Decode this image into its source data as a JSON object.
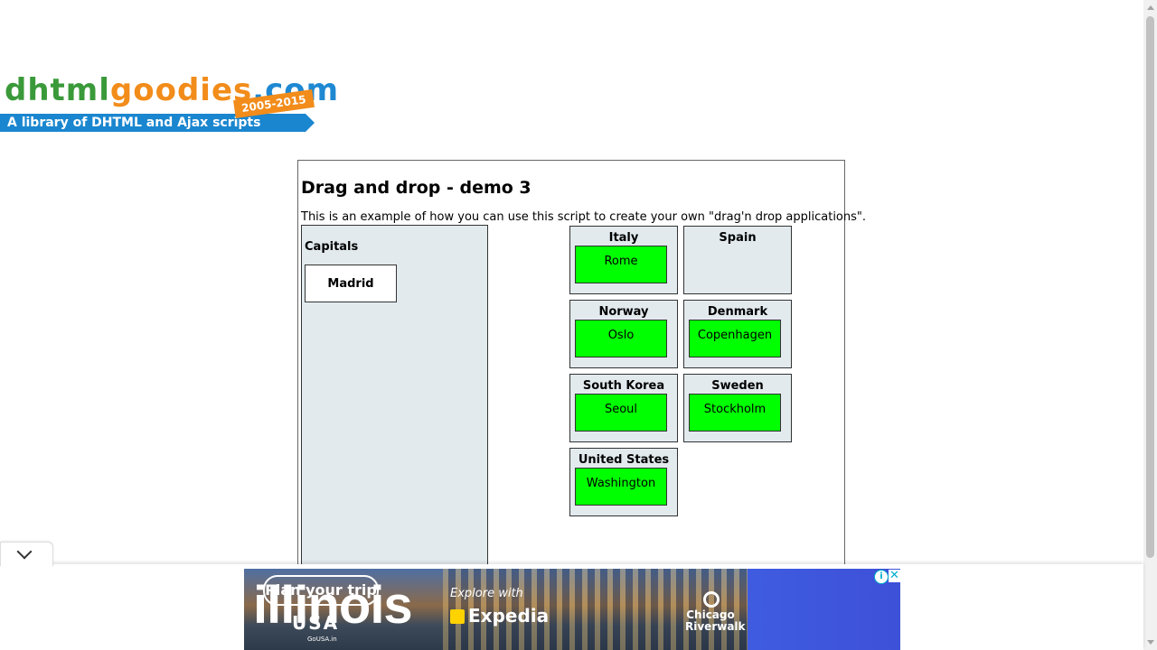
{
  "logo": {
    "part1": "dhtml",
    "part2": "goodies",
    "part3": ".com",
    "tagline": "A library of DHTML and Ajax scripts",
    "years": "2005-2015"
  },
  "page": {
    "title": "Drag and drop - demo 3",
    "intro": "This is an example of how you can use this script to create your own \"drag'n drop applications\"."
  },
  "capitals_box": {
    "title": "Capitals",
    "items": [
      "Madrid"
    ]
  },
  "countries": [
    {
      "name": "Italy",
      "capital": "Rome"
    },
    {
      "name": "Spain",
      "capital": ""
    },
    {
      "name": "Norway",
      "capital": "Oslo"
    },
    {
      "name": "Denmark",
      "capital": "Copenhagen"
    },
    {
      "name": "South Korea",
      "capital": "Seoul"
    },
    {
      "name": "Sweden",
      "capital": "Stockholm"
    },
    {
      "name": "United States",
      "capital": "Washington"
    }
  ],
  "colors": {
    "placed_tile": "#00ff00",
    "drop_area": "#e2eaee"
  },
  "ad": {
    "brand": "illinois",
    "explore": "Explore with",
    "partner": "Expedia",
    "location_line1": "Chicago",
    "location_line2": "Riverwalk",
    "cta": "Plan your trip",
    "usa": "USA",
    "gousa": "GoUSA.in",
    "adchoice": "i",
    "close": "✕"
  }
}
